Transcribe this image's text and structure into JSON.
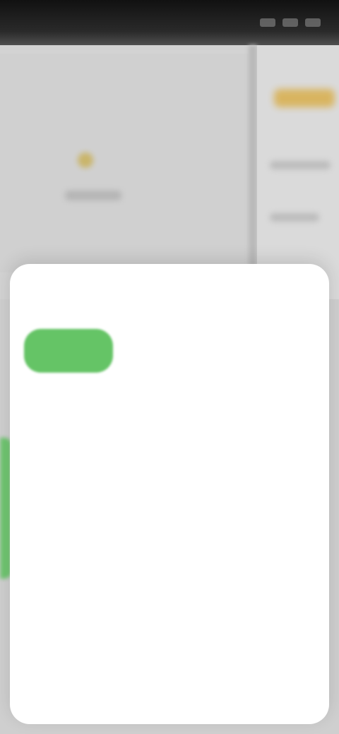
{
  "status_bar": {
    "time": "",
    "icons": [
      "signal-icon",
      "wifi-icon",
      "battery-icon"
    ]
  },
  "background": {
    "icons": [
      "map-pin-icon"
    ]
  },
  "sheet": {
    "title": "",
    "options": [
      {
        "label": "",
        "selected": true
      },
      {
        "label": "",
        "selected": false
      },
      {
        "label": "",
        "selected": false
      },
      {
        "label": "",
        "selected": false
      },
      {
        "label": "",
        "selected": false
      },
      {
        "label": "",
        "selected": false
      },
      {
        "label": "",
        "selected": false
      },
      {
        "label": "",
        "selected": false
      },
      {
        "label": "",
        "selected": false
      },
      {
        "label": "",
        "selected": false
      },
      {
        "label": "",
        "selected": false
      },
      {
        "label": "",
        "selected": false
      },
      {
        "label": "",
        "selected": false
      },
      {
        "label": "",
        "selected": false
      },
      {
        "label": "",
        "selected": false
      },
      {
        "label": "",
        "selected": false
      },
      {
        "label": "",
        "selected": false
      },
      {
        "label": "",
        "selected": false
      }
    ]
  },
  "colors": {
    "accent": "#65c466",
    "sheet_background": "#ffffff",
    "overlay": "#cfcfcf"
  }
}
